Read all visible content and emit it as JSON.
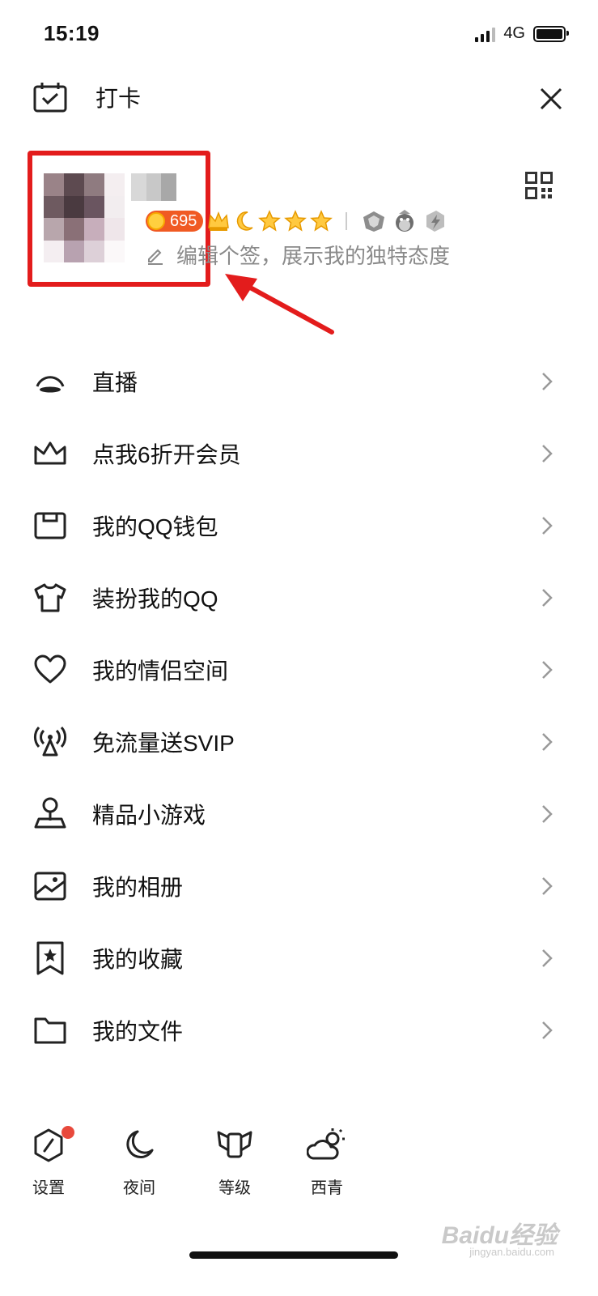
{
  "status_bar": {
    "time": "15:19",
    "network": "4G"
  },
  "header": {
    "checkin_label": "打卡",
    "checkin_icon": "calendar-check-icon",
    "close_icon": "close-icon",
    "qr_icon": "qr-code-icon"
  },
  "profile": {
    "points": "695",
    "signature_placeholder": "编辑个签，展示我的独特态度",
    "edit_icon": "pencil-icon"
  },
  "menu": {
    "items": [
      {
        "label": "直播",
        "icon": "live-icon"
      },
      {
        "label": "点我6折开会员",
        "icon": "crown-icon"
      },
      {
        "label": "我的QQ钱包",
        "icon": "wallet-icon"
      },
      {
        "label": "装扮我的QQ",
        "icon": "tshirt-icon"
      },
      {
        "label": "我的情侣空间",
        "icon": "heart-icon"
      },
      {
        "label": "免流量送SVIP",
        "icon": "signal-tower-icon"
      },
      {
        "label": "精品小游戏",
        "icon": "game-pin-icon"
      },
      {
        "label": "我的相册",
        "icon": "photo-album-icon"
      },
      {
        "label": "我的收藏",
        "icon": "bookmark-star-icon"
      },
      {
        "label": "我的文件",
        "icon": "folder-icon"
      }
    ]
  },
  "bottom_bar": {
    "items": [
      {
        "label": "设置",
        "icon": "settings-hex-icon"
      },
      {
        "label": "夜间",
        "icon": "moon-icon"
      },
      {
        "label": "等级",
        "icon": "level-wings-icon"
      },
      {
        "label": "西青",
        "icon": "weather-cloud-sun-icon"
      }
    ]
  },
  "watermark": {
    "brand": "Baidu经验",
    "url": "jingyan.baidu.com"
  },
  "colors": {
    "accent_red": "#e31c1c",
    "coin_orange": "#f05a23",
    "dot_red": "#e8493c",
    "text_gray": "#8a8a8a"
  }
}
